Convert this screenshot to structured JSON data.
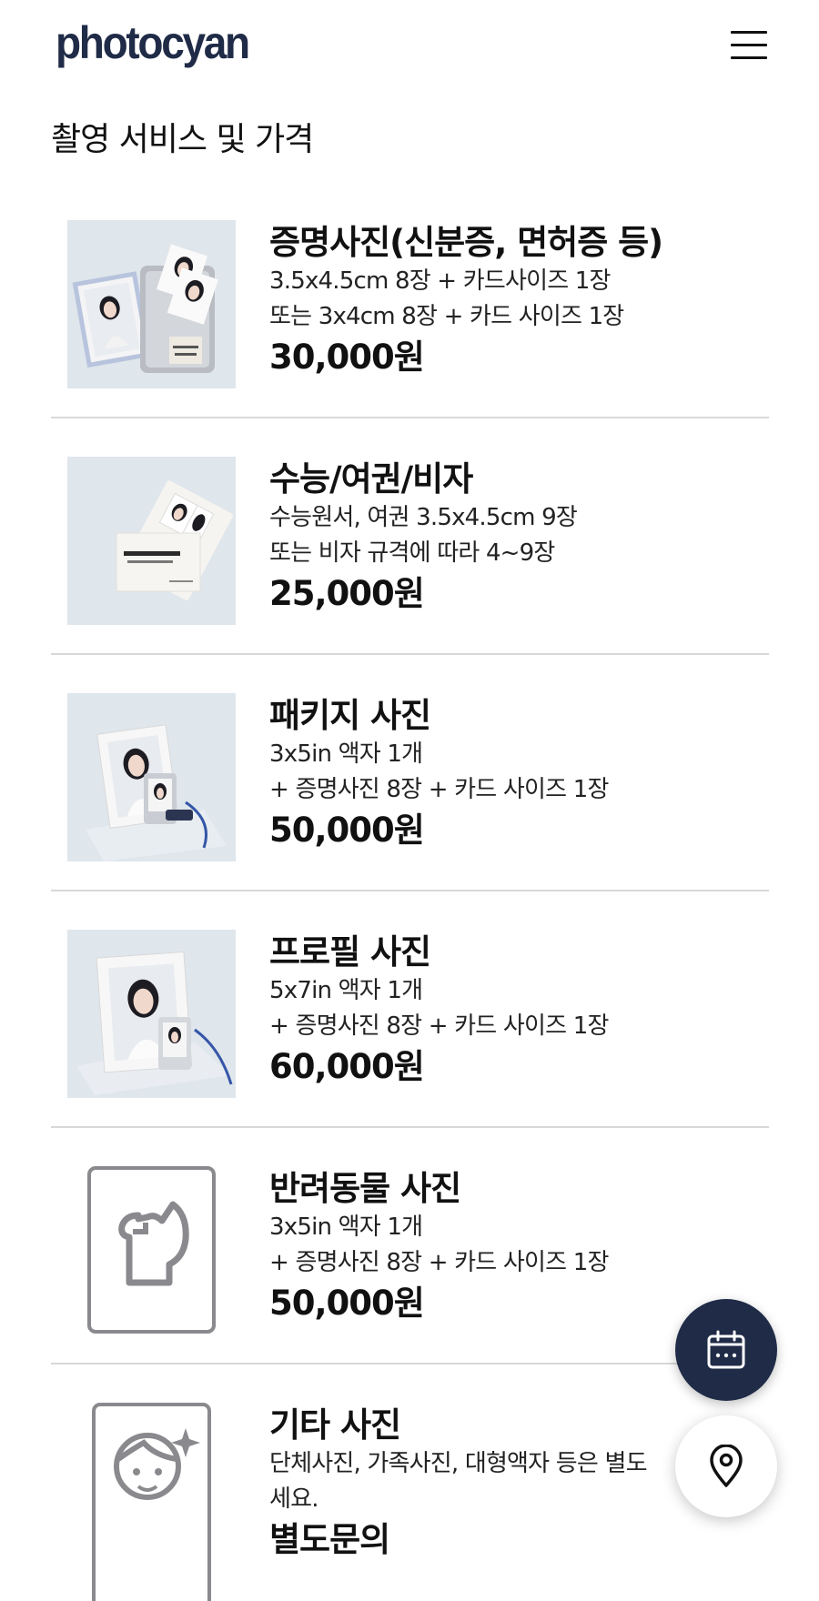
{
  "header": {
    "logo": "photocyan",
    "menu_icon": "hamburger-menu-icon"
  },
  "page_title": "촬영 서비스 및 가격",
  "services": [
    {
      "name": "증명사진(신분증, 면허증 등)",
      "desc": [
        "3.5x4.5cm 8장 + 카드사이즈 1장",
        "또는 3x4cm 8장 + 카드 사이즈 1장"
      ],
      "price": "30,000원"
    },
    {
      "name": "수능/여권/비자",
      "desc": [
        "수능원서, 여권 3.5x4.5cm 9장",
        "또는 비자 규격에 따라 4~9장"
      ],
      "price": "25,000원"
    },
    {
      "name": "패키지 사진",
      "desc": [
        "3x5in 액자 1개",
        "+ 증명사진 8장 + 카드 사이즈 1장"
      ],
      "price": "50,000원"
    },
    {
      "name": "프로필 사진",
      "desc": [
        "5x7in 액자 1개",
        "+ 증명사진 8장 + 카드 사이즈 1장"
      ],
      "price": "60,000원"
    },
    {
      "name": "반려동물 사진",
      "desc": [
        "3x5in 액자 1개",
        "+ 증명사진 8장 + 카드 사이즈 1장"
      ],
      "price": "50,000원"
    },
    {
      "name": "기타 사진",
      "desc": [
        "단체사진, 가족사진, 대형액자 등은 별도",
        "세요."
      ],
      "price": "별도문의"
    }
  ],
  "fabs": {
    "calendar_icon": "calendar-icon",
    "location_icon": "location-pin-icon"
  },
  "colors": {
    "brand_navy": "#1f2b47",
    "thumb_bg": "#dfe6ec",
    "divider": "#d8d8d8",
    "icon_gray": "#8a8a8e"
  }
}
